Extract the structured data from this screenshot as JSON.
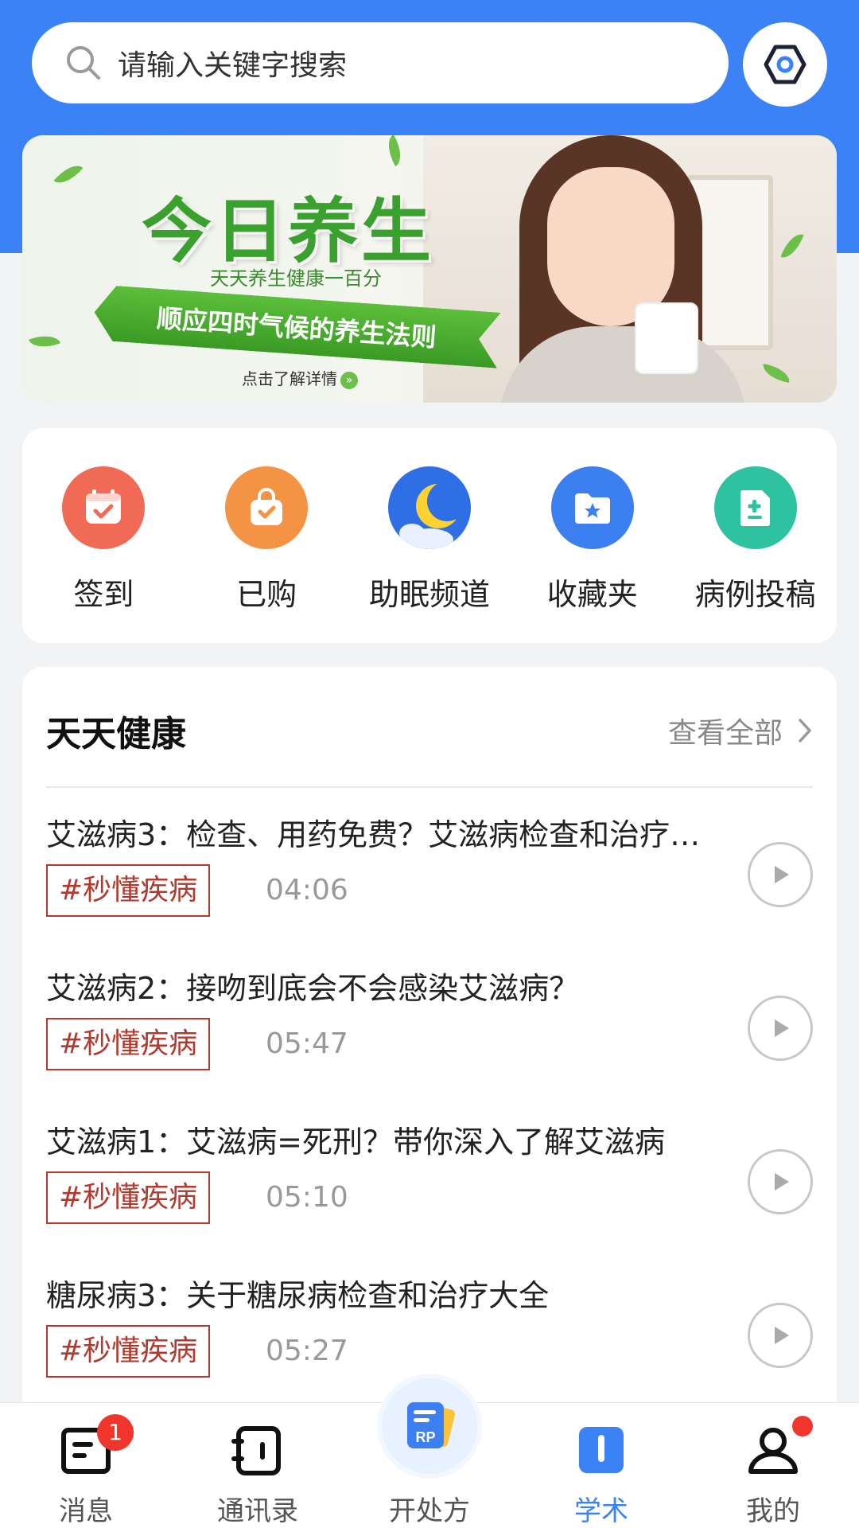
{
  "search": {
    "placeholder": "请输入关键字搜索"
  },
  "banner": {
    "title": "今日养生",
    "subtitle": "天天养生健康一百分",
    "ribbon": "顺应四时气候的养生法则",
    "link": "点击了解详情"
  },
  "shortcuts": [
    {
      "label": "签到",
      "icon": "calendar-check-icon",
      "color": "#f06a55"
    },
    {
      "label": "已购",
      "icon": "shopping-bag-icon",
      "color": "#f59345"
    },
    {
      "label": "助眠频道",
      "icon": "moon-icon",
      "color": "#2f6fe6"
    },
    {
      "label": "收藏夹",
      "icon": "star-folder-icon",
      "color": "#3b7ff0"
    },
    {
      "label": "病例投稿",
      "icon": "medical-document-icon",
      "color": "#2fc2a0"
    }
  ],
  "health": {
    "title": "天天健康",
    "view_all": "查看全部",
    "items": [
      {
        "title": "艾滋病3：检查、用药免费？艾滋病检查和治疗…",
        "tag": "#秒懂疾病",
        "duration": "04:06"
      },
      {
        "title": "艾滋病2：接吻到底会不会感染艾滋病？",
        "tag": "#秒懂疾病",
        "duration": "05:47"
      },
      {
        "title": "艾滋病1：艾滋病=死刑？带你深入了解艾滋病",
        "tag": "#秒懂疾病",
        "duration": "05:10"
      },
      {
        "title": "糖尿病3：关于糖尿病检查和治疗大全",
        "tag": "#秒懂疾病",
        "duration": "05:27"
      }
    ]
  },
  "tabbar": {
    "messages": {
      "label": "消息",
      "badge": "1"
    },
    "contacts": {
      "label": "通讯录"
    },
    "prescribe": {
      "label": "开处方",
      "icon_text": "RP"
    },
    "academic": {
      "label": "学术"
    },
    "mine": {
      "label": "我的"
    }
  },
  "colors": {
    "primary": "#3b82f6",
    "tag": "#b03a2e",
    "badge": "#f0352c"
  }
}
